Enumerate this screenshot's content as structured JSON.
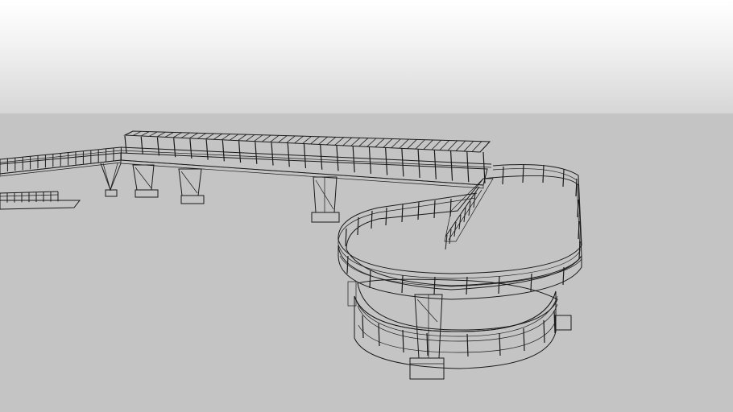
{
  "scene": {
    "sky_color": "#efefef",
    "ground_color": "#c4c4c4",
    "deck_color": "#8c8c8c",
    "wall_color": "#ffffff",
    "line_color": "#1a1a1a"
  }
}
